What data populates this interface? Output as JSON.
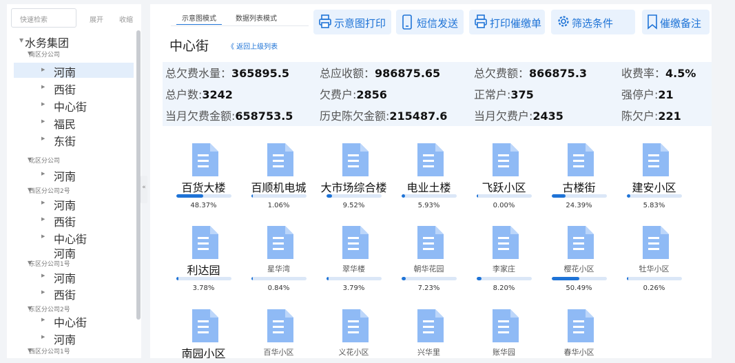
{
  "sidebar": {
    "search_placeholder": "快速检索",
    "expand_label": "展开",
    "collapse_label": "收缩",
    "collapse_handle": "«",
    "tree": [
      {
        "label": "水务集团",
        "level": 0,
        "size": "big",
        "arrow": true
      },
      {
        "label": "南区分公司",
        "level": 1,
        "size": "small",
        "arrow": true
      },
      {
        "label": "河南",
        "level": 2,
        "size": "big",
        "arrow": true,
        "selected": true
      },
      {
        "label": "西街",
        "level": 2,
        "size": "big",
        "arrow": true
      },
      {
        "label": "中心街",
        "level": 2,
        "size": "big",
        "arrow": true
      },
      {
        "label": "福民",
        "level": 2,
        "size": "big",
        "arrow": true
      },
      {
        "label": "东街",
        "level": 2,
        "size": "big",
        "arrow": true
      },
      {
        "label": "北区分公司",
        "level": 1,
        "size": "small",
        "arrow": true
      },
      {
        "label": "河南",
        "level": 2,
        "size": "big",
        "arrow": true
      },
      {
        "label": "西区分公司2号",
        "level": 1,
        "size": "small",
        "arrow": true
      },
      {
        "label": "河南",
        "level": 2,
        "size": "big",
        "arrow": true
      },
      {
        "label": "西街",
        "level": 2,
        "size": "big",
        "arrow": true
      },
      {
        "label": "中心街",
        "level": 2,
        "size": "big",
        "arrow": true
      },
      {
        "label": "河南",
        "level": 2,
        "size": "big",
        "arrow": false
      },
      {
        "label": "东区分公司1号",
        "level": 1,
        "size": "small",
        "arrow": true
      },
      {
        "label": "河南",
        "level": 2,
        "size": "big",
        "arrow": true
      },
      {
        "label": "西街",
        "level": 2,
        "size": "big",
        "arrow": true
      },
      {
        "label": "东区分公司2号",
        "level": 1,
        "size": "small",
        "arrow": true
      },
      {
        "label": "中心街",
        "level": 2,
        "size": "big",
        "arrow": true
      },
      {
        "label": "河南",
        "level": 2,
        "size": "big",
        "arrow": true
      },
      {
        "label": "西区分公司1号",
        "level": 1,
        "size": "small",
        "arrow": true
      }
    ]
  },
  "tabs": [
    {
      "label": "示意图模式",
      "active": true
    },
    {
      "label": "数据列表模式",
      "active": false
    }
  ],
  "toolbar": [
    {
      "label": "示意图打印",
      "icon": "printer-icon"
    },
    {
      "label": "短信发送",
      "icon": "phone-icon"
    },
    {
      "label": "打印催缴单",
      "icon": "printer-icon"
    },
    {
      "label": "筛选条件",
      "icon": "gear-icon"
    },
    {
      "label": "催缴备注",
      "icon": "bookmark-icon"
    }
  ],
  "location": {
    "title": "中心街",
    "back_link": "《 返回上级列表"
  },
  "stats": [
    [
      {
        "label": "总欠费水量：",
        "value": "365895.5"
      },
      {
        "label": "总应收额：",
        "value": "986875.65"
      },
      {
        "label": "总欠费额：",
        "value": "866875.3"
      },
      {
        "label": "收费率：",
        "value": "4.5%"
      }
    ],
    [
      {
        "label": "总户数:",
        "value": "3242"
      },
      {
        "label": "欠费户:",
        "value": "2856"
      },
      {
        "label": "正常户:",
        "value": "375"
      },
      {
        "label": "强停户:",
        "value": "21"
      }
    ],
    [
      {
        "label": "当月欠费金额:",
        "value": "658753.5"
      },
      {
        "label": "历史陈欠金额:",
        "value": "215487.6"
      },
      {
        "label": "当月欠费户:",
        "value": "2435"
      },
      {
        "label": "陈欠户:",
        "value": "221"
      }
    ]
  ],
  "buildings": [
    {
      "name": "百货大楼",
      "percent": "48.37%",
      "fill": 0.4837,
      "big": true
    },
    {
      "name": "百顺机电城",
      "percent": "1.06%",
      "fill": 0.0106,
      "big": true
    },
    {
      "name": "大市场综合楼",
      "percent": "9.52%",
      "fill": 0.0952,
      "big": true
    },
    {
      "name": "电业土楼",
      "percent": "5.93%",
      "fill": 0.0593,
      "big": true
    },
    {
      "name": "飞跃小区",
      "percent": "0.00%",
      "fill": 0.0,
      "big": true
    },
    {
      "name": "古楼街",
      "percent": "24.39%",
      "fill": 0.2439,
      "big": true
    },
    {
      "name": "建安小区",
      "percent": "5.83%",
      "fill": 0.0583,
      "big": true
    },
    {
      "name": "利达园",
      "percent": "3.78%",
      "fill": 0.0378,
      "big": true
    },
    {
      "name": "星华湾",
      "percent": "0.84%",
      "fill": 0.0084,
      "big": false
    },
    {
      "name": "翠华楼",
      "percent": "3.79%",
      "fill": 0.0379,
      "big": false
    },
    {
      "name": "朝华花园",
      "percent": "7.23%",
      "fill": 0.0723,
      "big": false
    },
    {
      "name": "李家庄",
      "percent": "8.20%",
      "fill": 0.082,
      "big": false
    },
    {
      "name": "樱花小区",
      "percent": "50.49%",
      "fill": 0.5049,
      "big": false
    },
    {
      "name": "牡华小区",
      "percent": "0.26%",
      "fill": 0.0026,
      "big": false
    },
    {
      "name": "南园小区",
      "percent": "",
      "fill": null,
      "big": true
    },
    {
      "name": "百华小区",
      "percent": "",
      "fill": null,
      "big": false
    },
    {
      "name": "义花小区",
      "percent": "",
      "fill": null,
      "big": false
    },
    {
      "name": "兴华里",
      "percent": "",
      "fill": null,
      "big": false
    },
    {
      "name": "账华园",
      "percent": "",
      "fill": null,
      "big": false
    },
    {
      "name": "春华小区",
      "percent": "",
      "fill": null,
      "big": false
    }
  ],
  "colors": {
    "accent": "#1e73d6",
    "building": "#8fbaf5",
    "stats_bg": "#eff5fc"
  }
}
